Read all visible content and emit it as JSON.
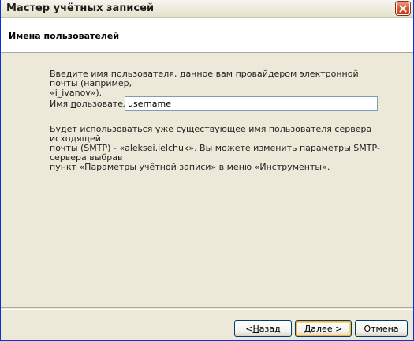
{
  "window": {
    "title": "Мастер учётных записей"
  },
  "header": {
    "title": "Имена пользователей"
  },
  "content": {
    "intro_line1": "Введите имя пользователя, данное вам провайдером электронной почты (например,",
    "intro_line2": "«i_ivanov»).",
    "username_label_prefix": "Имя ",
    "username_label_accel": "п",
    "username_label_suffix": "ользователя:",
    "username_value": "username",
    "note_line1": "Будет использоваться уже существующее имя пользователя сервера исходящей",
    "note_line2": "почты (SMTP) - «aleksei.lelchuk». Вы можете изменить параметры SMTP-сервера выбрав",
    "note_line3": "пункт «Параметры учётной записи» в меню «Инструменты»."
  },
  "buttons": {
    "back_prefix": "< ",
    "back_accel": "Н",
    "back_suffix": "азад",
    "next_accel": "Д",
    "next_suffix": "алее >",
    "cancel_label": "Отмена"
  }
}
